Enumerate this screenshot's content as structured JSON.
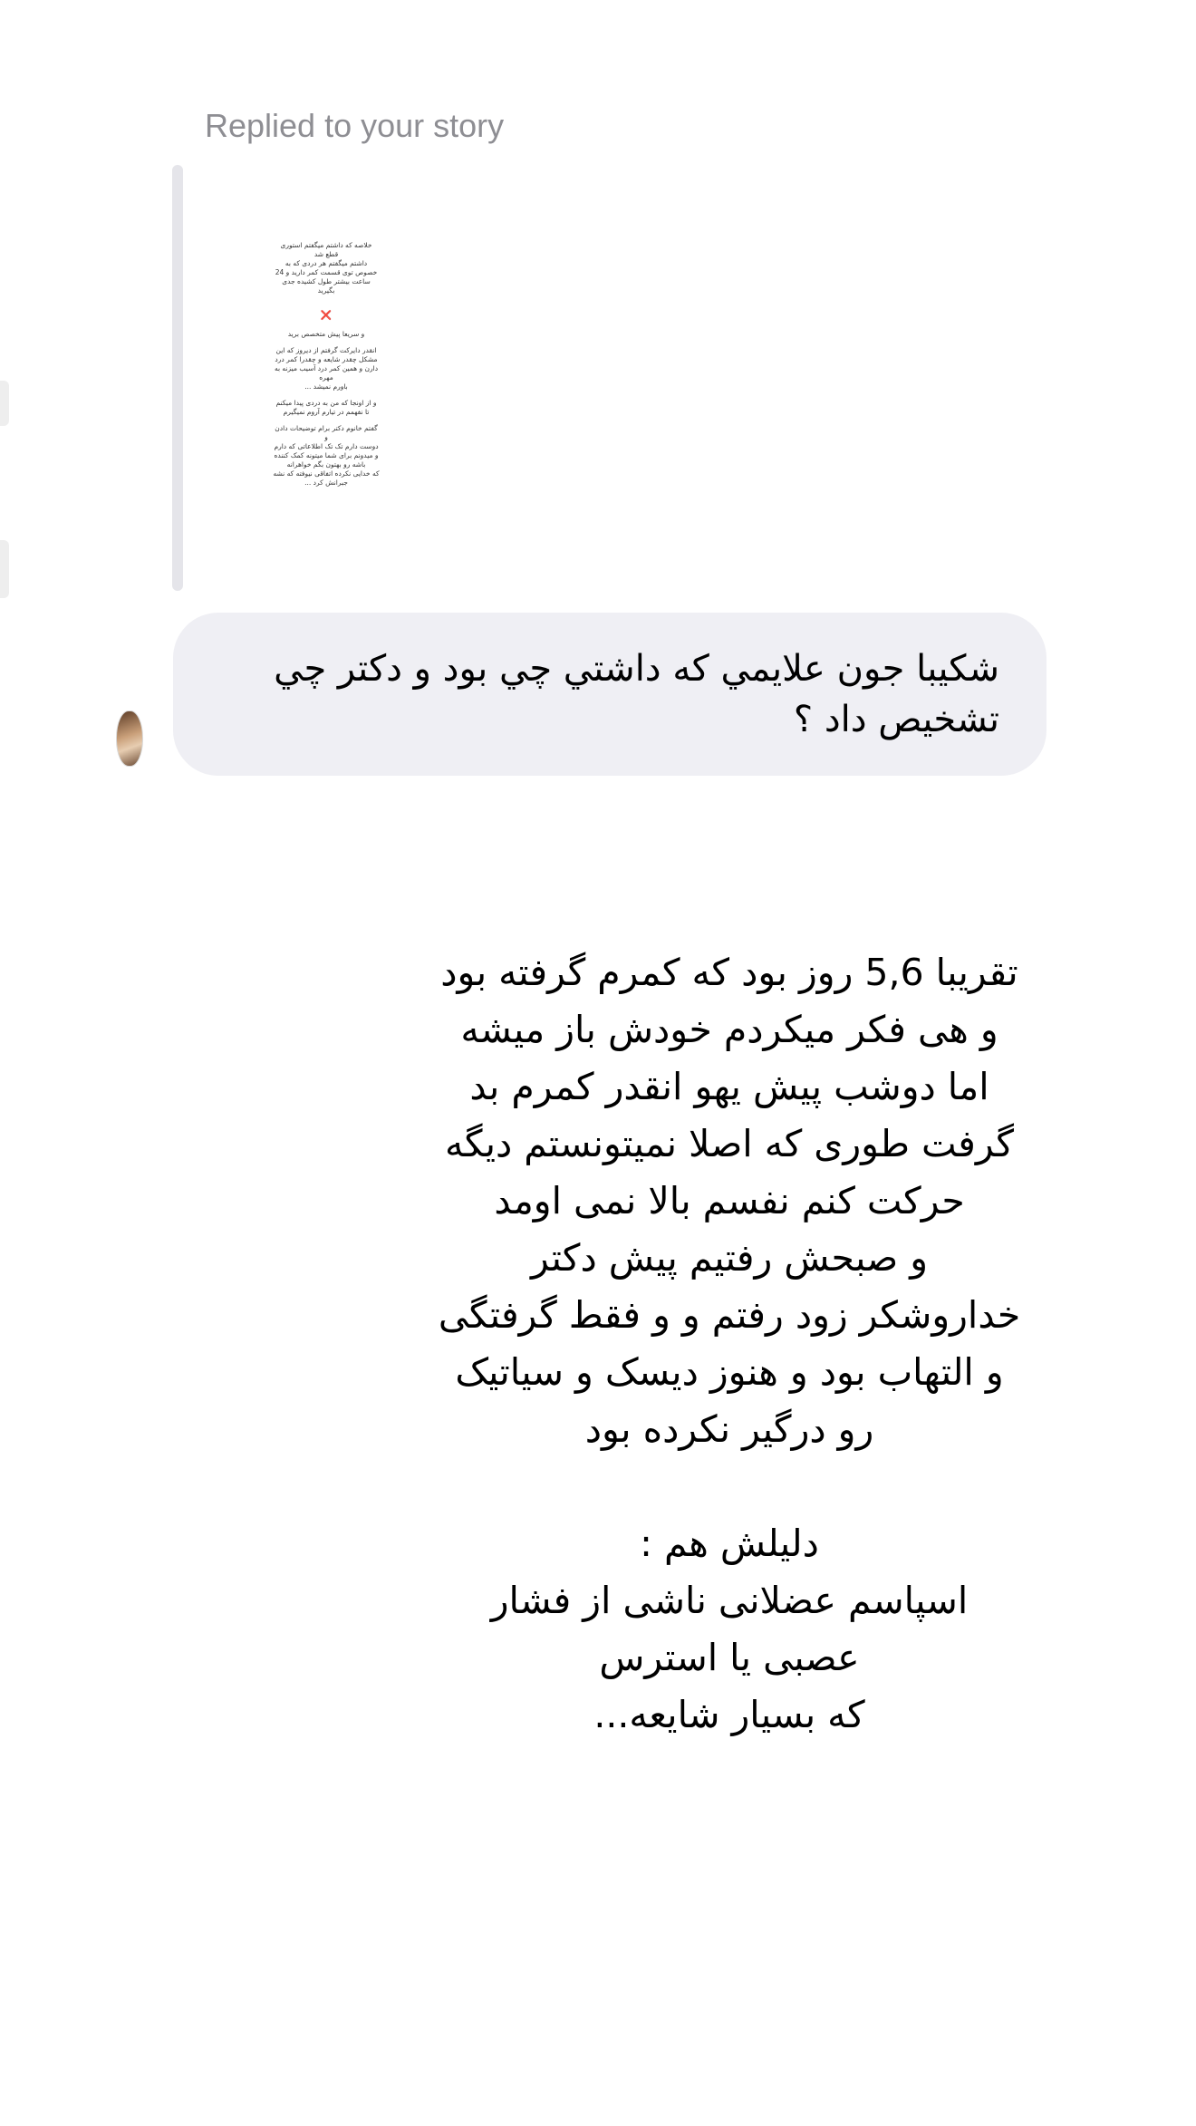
{
  "reply_header": {
    "label": "Replied to your story"
  },
  "story_preview": {
    "paragraphs": [
      "خلاصه که داشتم میگفتم استوری\nقطع شد\nداشتم میگفتم هر دردی که به\nخصوص توی قسمت کمر دارید و 24\nساعت بیشتر طول کشیده جدی\nبگیرید",
      "و سریعا پیش متخصص برید",
      "انقدر دایرکت گرفتم از دیروز که این\nمشکل چقدر شایعه و چقدرا کمر درد\nدارن و همین کمر درد آسیب میزنه به\nمهره\nباورم نمیشد ...",
      "و از اونجا که من به دردی پیدا میکنم\nتا نفهمم در تیارم آروم نمیگیرم",
      "گفتم خانوم دکتر برام توضیحات دادن\nو\nدوست دارم تک تک اطلاعاتی که دارم\nو میدونم برای شما میتونه کمک کننده\nباشه رو بهتون بگم خواهرانه\nکه خدایی نکرده اتفاقی نیوفته که نشه\nجبرانش کرد ..."
    ],
    "mark_symbol": "❌"
  },
  "message_bubble": {
    "text": "شکیبا جون علایمي که داشتي چي بود و دکتر چي تشخیص داد ؟"
  },
  "story_reply_text": {
    "lines": [
      "تقریبا 5,6 روز بود که کمرم گرفته بود",
      "و هی فکر میکردم خودش باز میشه",
      "اما دوشب پیش یهو انقدر کمرم بد",
      "گرفت طوری که اصلا نمیتونستم دیگه",
      "حرکت کنم نفسم بالا نمی اومد",
      "و صبحش رفتیم پیش دکتر",
      "خداروشکر زود رفتم و و فقط گرفتگی",
      "و التهاب بود و هنوز دیسک و سیاتیک",
      "رو درگیر نکرده بود",
      "",
      "دلیلش هم :",
      "اسپاسم عضلانی ناشی از فشار",
      "عصبی یا استرس",
      "که بسیار شایعه..."
    ]
  },
  "colors": {
    "label_gray": "#8e8e93",
    "bubble_bg": "#efeff4",
    "story_bar": "#e5e5ea",
    "mark_red": "#e0261b"
  }
}
